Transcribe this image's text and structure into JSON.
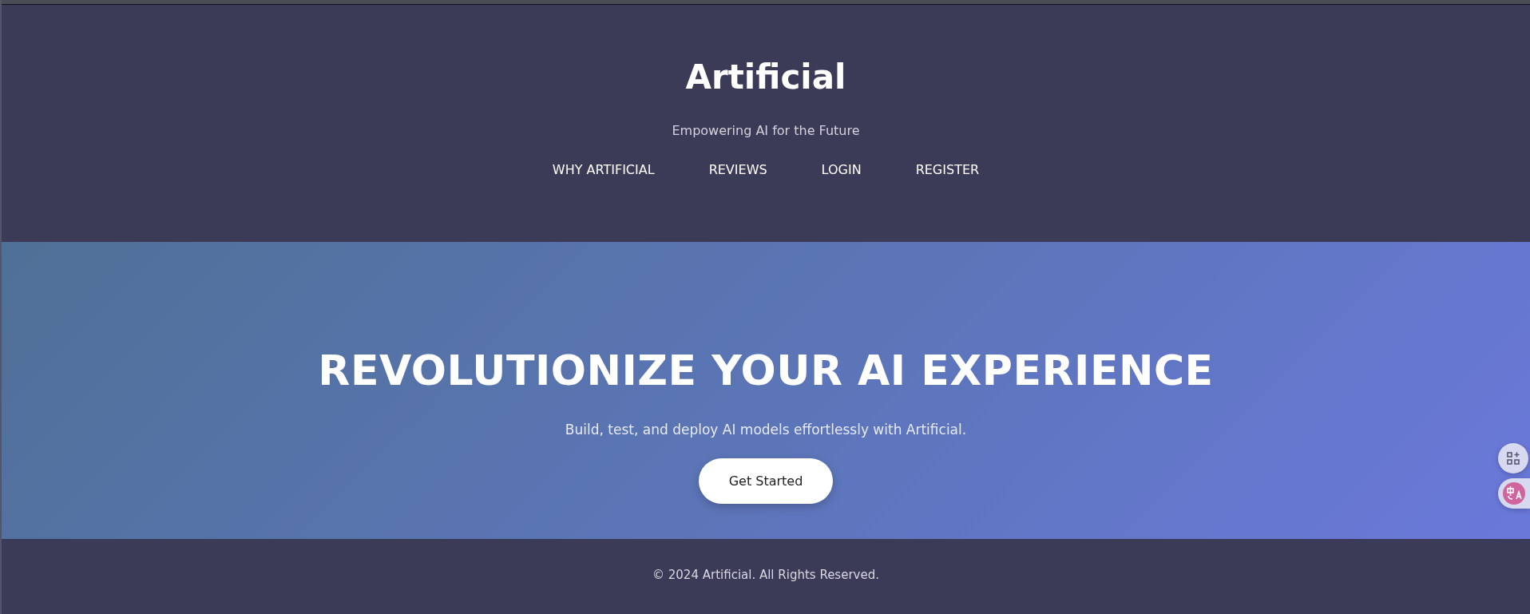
{
  "header": {
    "title": "Artificial",
    "tagline": "Empowering AI for the Future",
    "nav": [
      {
        "label": "WHY ARTIFICIAL"
      },
      {
        "label": "REVIEWS"
      },
      {
        "label": "LOGIN"
      },
      {
        "label": "REGISTER"
      }
    ]
  },
  "hero": {
    "heading": "REVOLUTIONIZE YOUR AI EXPERIENCE",
    "subheading": "Build, test, and deploy AI models effortlessly with Artificial.",
    "button": "Get Started"
  },
  "footer": {
    "text": "© 2024 Artificial. All Rights Reserved."
  }
}
